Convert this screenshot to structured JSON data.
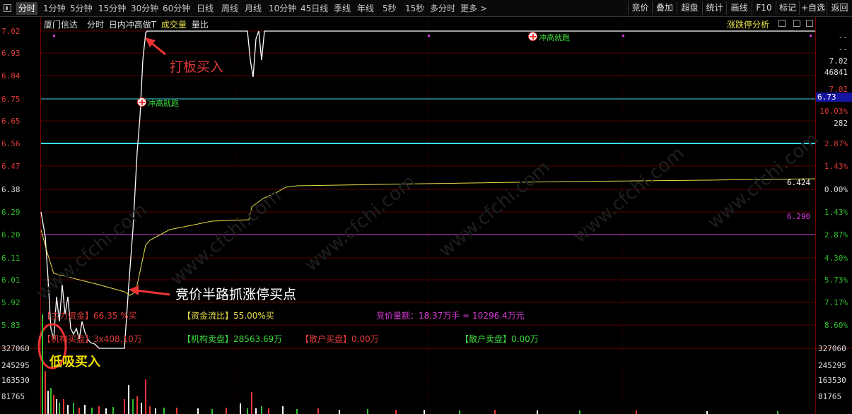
{
  "toolbar": {
    "tabs": [
      "分时",
      "1分钟",
      "5分钟",
      "15分钟",
      "30分钟",
      "60分钟",
      "日线",
      "周线",
      "月线",
      "10分钟",
      "45日线",
      "季线",
      "年线",
      "5秒",
      "15秒",
      "多分时",
      "更多 >"
    ],
    "active": "分时",
    "right_buttons": [
      "竞价",
      "叠加",
      "超盘",
      "统计",
      "画线",
      "F10",
      "标记",
      "+自选",
      "返回"
    ]
  },
  "header": {
    "stock_name": "厦门信达",
    "mode": "分时",
    "indicator": "日内冲高做T",
    "volume_label": "成交量",
    "ratio_label": "量比",
    "right_link": "涨跌停分析"
  },
  "price_axis": [
    "7.02",
    "6.93",
    "6.84",
    "6.75",
    "6.65",
    "6.56",
    "6.47",
    "6.38",
    "6.29",
    "6.20",
    "6.11",
    "6.01",
    "5.92",
    "5.83"
  ],
  "pct_axis": [
    "",
    "",
    "",
    "10.03%",
    "",
    "2.87%",
    "1.43%",
    "0.00%",
    "1.43%",
    "2.87%",
    "4.30%",
    "5.73%",
    "7.17%",
    "8.60%"
  ],
  "volume_axis": [
    "327060",
    "245295",
    "163530",
    "81765"
  ],
  "right_panel": {
    "dash1": "--",
    "dash2": "--",
    "price": "7.02",
    "vol": "46841",
    "price2": "7.02",
    "current": "6.73",
    "pct": "10.03%",
    "num": "282",
    "avg": "6.424",
    "ref": "6.290"
  },
  "overlay": {
    "fund_main": "【主力资金】66.35 %买",
    "fund_ratio": "【资金流比】55.00%买",
    "auction": "竞价量额：18.37万手 = 10296.4万元",
    "inst_buy": "【机构买盘】3x408.10万",
    "inst_sell": "【机构卖盘】28563.69万",
    "retail_buy": "【散户买盘】0.00万",
    "retail_sell": "【散户卖盘】0.00万"
  },
  "signals": {
    "s1": "冲高就跑",
    "s2": "冲高就跑"
  },
  "annotations": {
    "a1": "打板买入",
    "a2": "竞价半路抓涨停买点",
    "a3": "低吸买入"
  },
  "watermark": "www.cfchi.com",
  "colors": {
    "up": "#e03a3a",
    "down": "#2fbf2f",
    "price_line": "#ffffff",
    "avg_line": "#e8e04a",
    "cyan": "#39e0e8",
    "magenta": "#d93bd9"
  }
}
